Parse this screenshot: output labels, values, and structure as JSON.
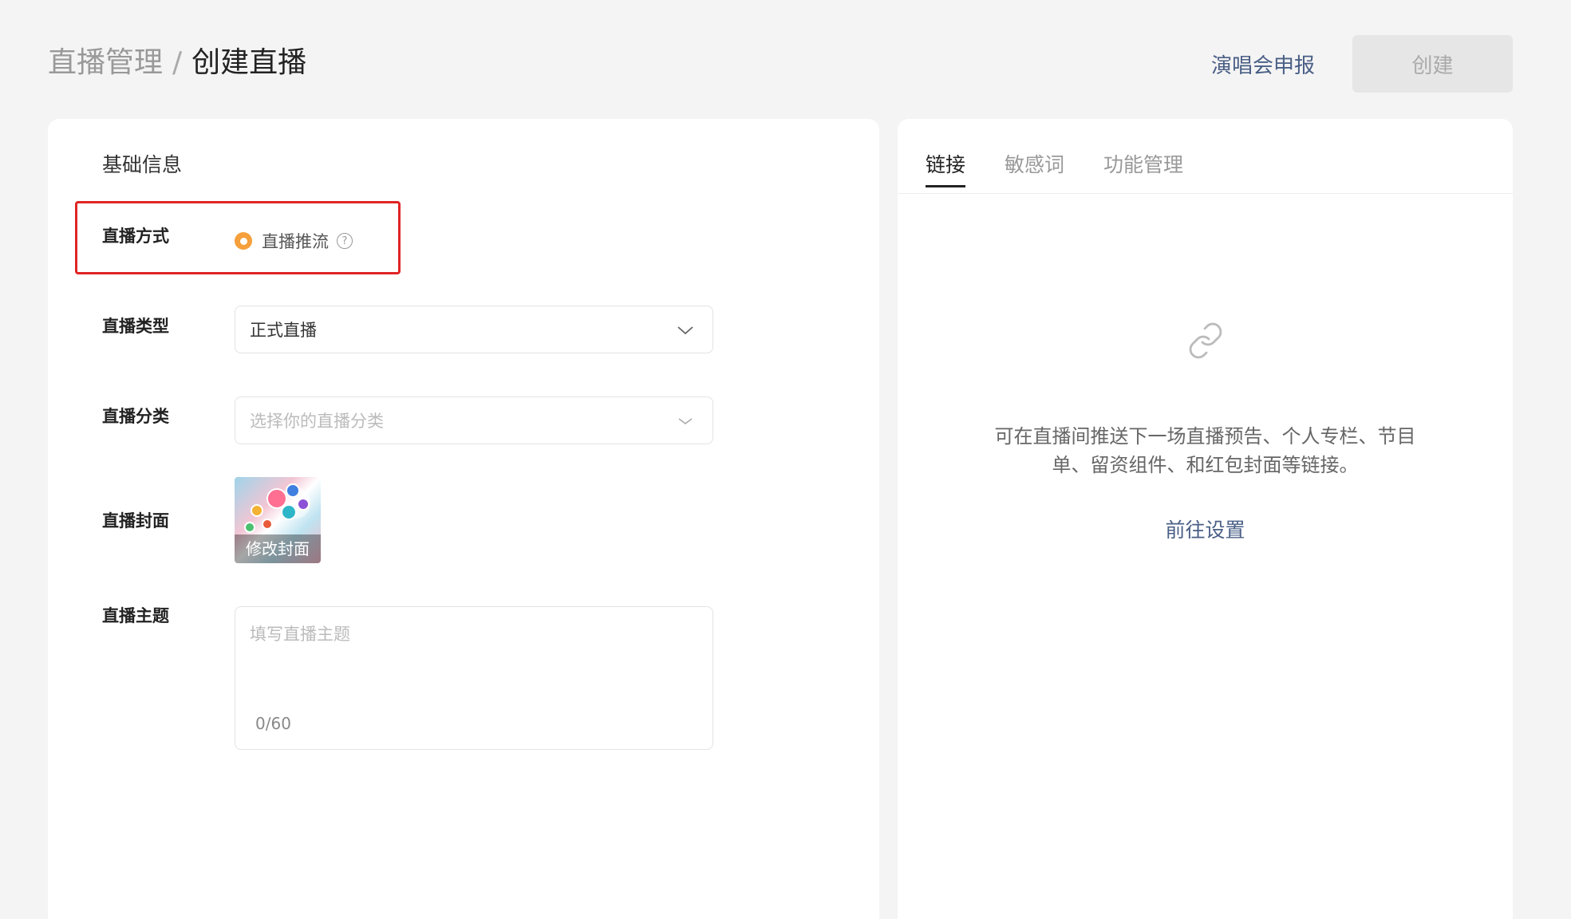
{
  "header": {
    "breadcrumb_parent": "直播管理",
    "breadcrumb_sep": "/",
    "breadcrumb_current": "创建直播",
    "concert_link": "演唱会申报",
    "create_button": "创建"
  },
  "form": {
    "section_title": "基础信息",
    "method": {
      "label": "直播方式",
      "option": "直播推流",
      "help_glyph": "?"
    },
    "type": {
      "label": "直播类型",
      "value": "正式直播"
    },
    "category": {
      "label": "直播分类",
      "placeholder": "选择你的直播分类"
    },
    "cover": {
      "label": "直播封面",
      "action": "修改封面"
    },
    "topic": {
      "label": "直播主题",
      "placeholder": "填写直播主题",
      "counter": "0/60"
    }
  },
  "panel": {
    "tabs": [
      {
        "label": "链接",
        "active": true
      },
      {
        "label": "敏感词",
        "active": false
      },
      {
        "label": "功能管理",
        "active": false
      }
    ],
    "empty_text": "可在直播间推送下一场直播预告、个人专栏、节目单、留资组件、和红包封面等链接。",
    "goto_link": "前往设置"
  },
  "colors": {
    "accent_link": "#4a5f86",
    "radio": "#f5a03c",
    "highlight": "#e02424"
  },
  "icons": [
    "help-icon",
    "chevron-down-icon",
    "link-icon"
  ]
}
